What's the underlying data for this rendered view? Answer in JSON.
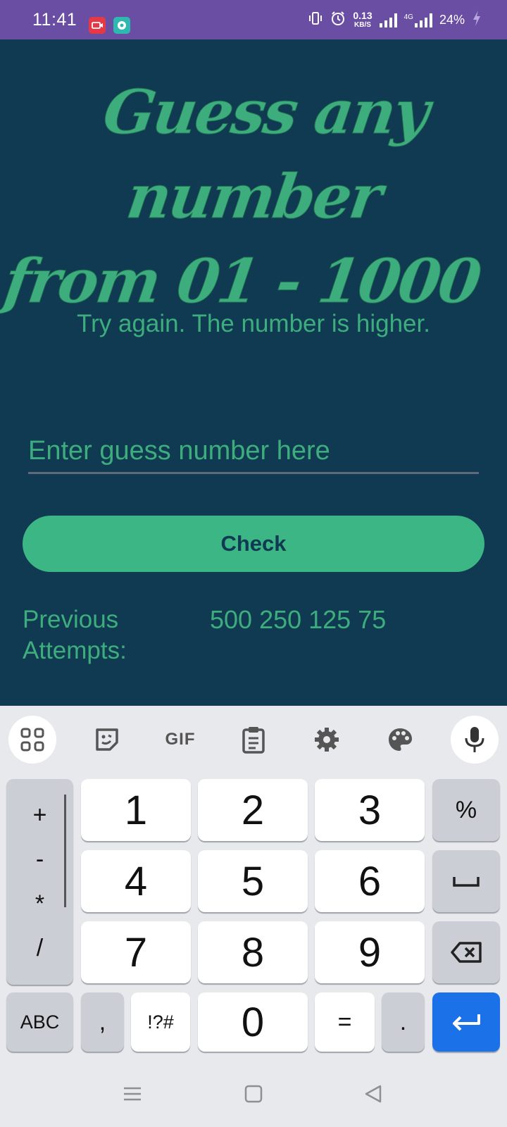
{
  "status_bar": {
    "time": "11:41",
    "net_speed_value": "0.13",
    "net_speed_unit": "KB/S",
    "network_type": "4G",
    "battery": "24%",
    "icons": [
      "screen-record-icon",
      "app-notification-icon",
      "vibrate-icon",
      "alarm-icon",
      "signal-icon",
      "signal-4g-icon",
      "charging-icon"
    ]
  },
  "app": {
    "title_line1": "Guess any number",
    "title_line2": "from 01 - 1000",
    "feedback": "Try again. The number is higher.",
    "input_placeholder": "Enter guess number here",
    "input_value": "",
    "check_label": "Check",
    "previous_label": "Previous Attempts:",
    "previous_values": "500 250 125 75",
    "colors": {
      "background": "#0f3a52",
      "accent": "#3db685",
      "status_bar": "#6a4ea3"
    }
  },
  "keyboard": {
    "toolbar": [
      "apps-grid-icon",
      "sticker-icon",
      "gif-icon",
      "clipboard-icon",
      "settings-gear-icon",
      "palette-icon",
      "microphone-icon"
    ],
    "toolbar_gif_label": "GIF",
    "ops": [
      "+",
      "-",
      "*",
      "/"
    ],
    "digits": [
      "1",
      "2",
      "3",
      "4",
      "5",
      "6",
      "7",
      "8",
      "9",
      "0"
    ],
    "percent": "%",
    "abc": "ABC",
    "comma": ",",
    "symbols": "!?#",
    "equals": "=",
    "period": "."
  },
  "nav_bar": [
    "recents-menu-icon",
    "home-square-icon",
    "back-triangle-icon"
  ]
}
